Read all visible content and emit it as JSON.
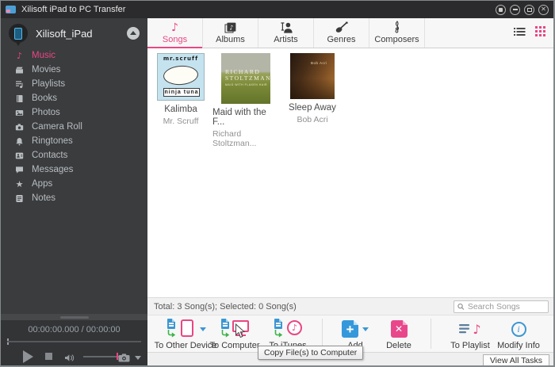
{
  "window": {
    "title": "Xilisoft iPad to PC Transfer"
  },
  "sidebar": {
    "device_name": "Xilisoft_iPad",
    "items": [
      {
        "label": "Music",
        "icon": "music-note-icon",
        "active": true
      },
      {
        "label": "Movies",
        "icon": "movie-icon",
        "active": false
      },
      {
        "label": "Playlists",
        "icon": "playlist-icon",
        "active": false
      },
      {
        "label": "Books",
        "icon": "book-icon",
        "active": false
      },
      {
        "label": "Photos",
        "icon": "photo-icon",
        "active": false
      },
      {
        "label": "Camera Roll",
        "icon": "camera-icon",
        "active": false
      },
      {
        "label": "Ringtones",
        "icon": "ringtone-icon",
        "active": false
      },
      {
        "label": "Contacts",
        "icon": "contact-icon",
        "active": false
      },
      {
        "label": "Messages",
        "icon": "message-icon",
        "active": false
      },
      {
        "label": "Apps",
        "icon": "apps-icon",
        "active": false
      },
      {
        "label": "Notes",
        "icon": "notes-icon",
        "active": false
      }
    ]
  },
  "tabs": [
    {
      "label": "Songs",
      "icon": "music-note-icon",
      "active": true
    },
    {
      "label": "Albums",
      "icon": "album-icon",
      "active": false
    },
    {
      "label": "Artists",
      "icon": "artist-icon",
      "active": false
    },
    {
      "label": "Genres",
      "icon": "guitar-icon",
      "active": false
    },
    {
      "label": "Composers",
      "icon": "treble-clef-icon",
      "active": false
    }
  ],
  "content": {
    "albums": [
      {
        "title": "Kalimba",
        "artist": "Mr. Scruff",
        "cover_text_top": "mr.scruff",
        "cover_text_bottom": "ninja tuna"
      },
      {
        "title": "Maid with the F...",
        "artist": "Richard Stoltzman...",
        "cover_line1": "RICHARD",
        "cover_line2": "STOLTZMAN",
        "cover_line3": "MAID WITH FLAXEN HAIR"
      },
      {
        "title": "Sleep Away",
        "artist": "Bob Acri",
        "cover_credit": "Bob Acri"
      }
    ]
  },
  "status_bar": {
    "summary": "Total: 3 Song(s); Selected: 0 Song(s)",
    "search_placeholder": "Search Songs"
  },
  "toolbar": {
    "buttons": [
      {
        "label": "To Other Device",
        "icon": "transfer-to-device-icon",
        "has_dropdown": true
      },
      {
        "label": "To Computer",
        "icon": "transfer-to-computer-icon",
        "has_dropdown": false
      },
      {
        "label": "To iTunes",
        "icon": "transfer-to-itunes-icon",
        "has_dropdown": false
      },
      {
        "label": "Add",
        "icon": "add-icon",
        "has_dropdown": true
      },
      {
        "label": "Delete",
        "icon": "delete-icon",
        "has_dropdown": false
      },
      {
        "label": "To Playlist",
        "icon": "playlist-add-icon",
        "has_dropdown": false
      },
      {
        "label": "Modify Info",
        "icon": "info-icon",
        "has_dropdown": false
      }
    ],
    "tooltip": "Copy File(s) to Computer",
    "view_all_tasks_label": "View All Tasks"
  },
  "player": {
    "time": "00:00:00.000 / 00:00:00"
  },
  "colors": {
    "accent": "#e94682",
    "blue": "#3b97d3",
    "green": "#3cb54a",
    "sidebar_bg": "#3a3c3e",
    "titlebar_bg": "#2b2b2d"
  }
}
